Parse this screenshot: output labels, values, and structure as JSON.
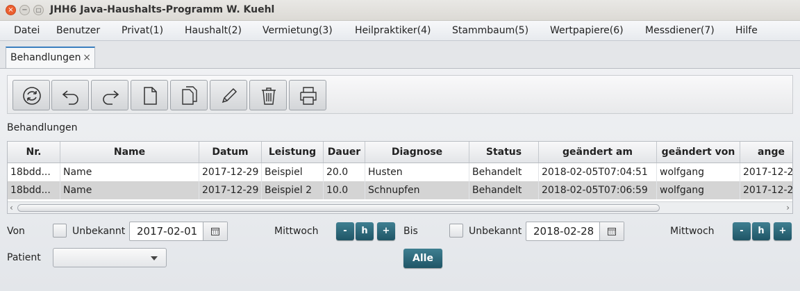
{
  "window": {
    "title": "JHH6 Java-Haushalts-Programm W. Kuehl"
  },
  "menu": [
    "Datei",
    "Benutzer",
    "Privat(1)",
    "Haushalt(2)",
    "Vermietung(3)",
    "Heilpraktiker(4)",
    "Stammbaum(5)",
    "Wertpapiere(6)",
    "Messdiener(7)",
    "Hilfe"
  ],
  "tab": {
    "label": "Behandlungen",
    "close": "×"
  },
  "toolbar": [
    "refresh-icon",
    "undo-icon",
    "redo-icon",
    "new-document-icon",
    "copy-icon",
    "edit-pencil-icon",
    "delete-trash-icon",
    "print-icon"
  ],
  "section_label": "Behandlungen",
  "table": {
    "columns": [
      "Nr.",
      "Name",
      "Datum",
      "Leistung",
      "Dauer",
      "Diagnose",
      "Status",
      "geändert am",
      "geändert von",
      "ange"
    ],
    "rows": [
      [
        "18bdd...",
        "Name",
        "2017-12-29",
        "Beispiel",
        "20.0",
        "Husten",
        "Behandelt",
        "2018-02-05T07:04:51",
        "wolfgang",
        "2017-12-2"
      ],
      [
        "18bdd...",
        "Name",
        "2017-12-29",
        "Beispiel 2",
        "10.0",
        "Schnupfen",
        "Behandelt",
        "2018-02-05T07:06:59",
        "wolfgang",
        "2017-12-2"
      ]
    ],
    "selected_row": 1
  },
  "filter": {
    "von_label": "Von",
    "von_unbekannt": "Unbekannt",
    "von_date": "2017-02-01",
    "von_weekday": "Mittwoch",
    "bis_label": "Bis",
    "bis_unbekannt": "Unbekannt",
    "bis_date": "2018-02-28",
    "bis_weekday": "Mittwoch",
    "step_minus": "-",
    "step_h": "h",
    "step_plus": "+",
    "patient_label": "Patient",
    "patient_value": "",
    "alle_button": "Alle"
  },
  "colors": {
    "accent_button": "#2c6475",
    "tab_accent": "#3a7fbf",
    "selected_row": "#d4d4d4"
  }
}
